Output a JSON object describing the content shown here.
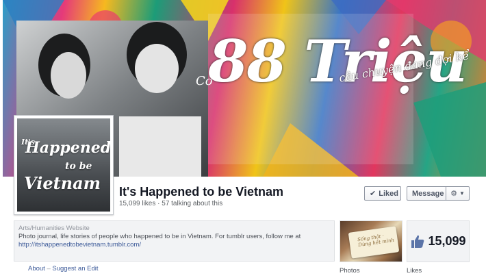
{
  "cover": {
    "headline": "88 Triệu",
    "prefix": "Có",
    "tagline": "câu chuyện đang đợi kể"
  },
  "profile_pic": {
    "line1": "It's",
    "line2": "Happened",
    "line3": "to be",
    "line4": "Vietnam"
  },
  "page": {
    "title": "It's Happened to be Vietnam",
    "stats": "15,099 likes · 57 talking about this"
  },
  "actions": {
    "liked_label": "Liked",
    "message_label": "Message"
  },
  "about": {
    "category": "Arts/Humanities Website",
    "description": "Photo journal, life stories of people who happened to be in Vietnam. For tumblr users, follow me at",
    "link": "http://itshappenedtobevietnam.tumblr.com/"
  },
  "footer_links": {
    "about": "About",
    "separator": "–",
    "suggest_edit": "Suggest an Edit"
  },
  "tiles": {
    "photos_label": "Photos",
    "photos_card_text": "Sống thật · Dùng hết mình",
    "likes_label": "Likes",
    "likes_count": "15,099"
  },
  "colors": {
    "link": "#3b5998",
    "like_thumb": "#5b74a8"
  },
  "icons": {
    "liked": "check-icon",
    "gear": "gear-icon",
    "dropdown": "chevron-down-icon",
    "likes_tile": "thumbs-up-icon"
  }
}
